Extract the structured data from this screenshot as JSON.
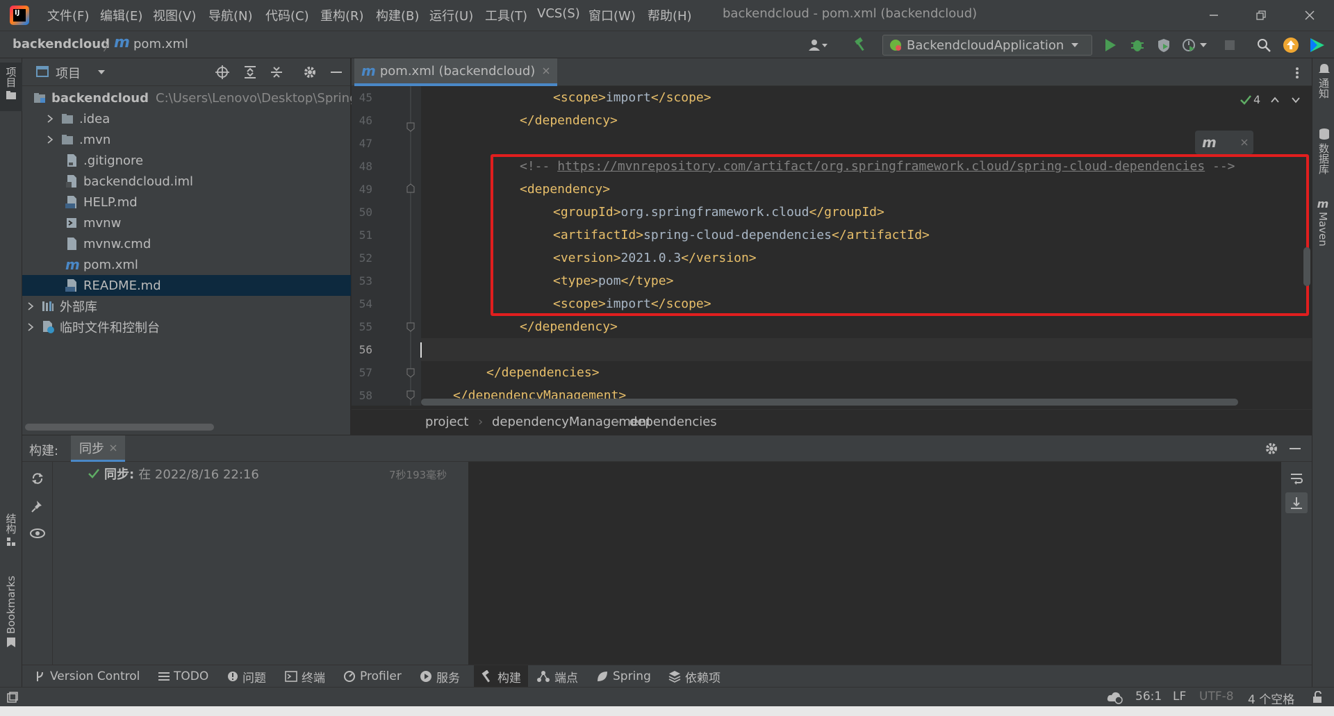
{
  "app": {
    "title": "backendcloud - pom.xml (backendcloud)"
  },
  "menu": [
    "文件(F)",
    "编辑(E)",
    "视图(V)",
    "导航(N)",
    "代码(C)",
    "重构(R)",
    "构建(B)",
    "运行(U)",
    "工具(T)",
    "VCS(S)",
    "窗口(W)",
    "帮助(H)"
  ],
  "nav": {
    "project": "backendcloud",
    "file": "pom.xml",
    "run_config": "BackendcloudApplication"
  },
  "left_strip": {
    "project_label": "项目",
    "structure_label": "结构",
    "bookmarks_label": "Bookmarks"
  },
  "right_strip": {
    "notifications_label": "通知",
    "database_label": "数据库",
    "maven_label": "Maven"
  },
  "project_panel": {
    "title": "项目",
    "root": {
      "name": "backendcloud",
      "path": "C:\\Users\\Lenovo\\Desktop\\Spring"
    },
    "items": [
      ".idea",
      ".mvn",
      ".gitignore",
      "backendcloud.iml",
      "HELP.md",
      "mvnw",
      "mvnw.cmd",
      "pom.xml",
      "README.md"
    ],
    "external_libraries": "外部库",
    "scratches": "临时文件和控制台"
  },
  "editor": {
    "tab_label": "pom.xml (backendcloud)",
    "inspection_count": "4",
    "line_numbers": [
      "45",
      "46",
      "47",
      "48",
      "49",
      "50",
      "51",
      "52",
      "53",
      "54",
      "55",
      "56",
      "57",
      "58"
    ],
    "code": {
      "l45_open": "<scope>",
      "l45_text": "import",
      "l45_close": "</scope>",
      "l46": "</dependency>",
      "l48_open": "<!-- ",
      "l48_url": "https://mvnrepository.com/artifact/org.springframework.cloud/spring-cloud-dependencies",
      "l48_close": " -->",
      "l49": "<dependency>",
      "l50_open": "<groupId>",
      "l50_text": "org.springframework.cloud",
      "l50_close": "</groupId>",
      "l51_open": "<artifactId>",
      "l51_text": "spring-cloud-dependencies",
      "l51_close": "</artifactId>",
      "l52_open": "<version>",
      "l52_text": "2021.0.3",
      "l52_close": "</version>",
      "l53_open": "<type>",
      "l53_text": "pom",
      "l53_close": "</type>",
      "l54_open": "<scope>",
      "l54_text": "import",
      "l54_close": "</scope>",
      "l55": "</dependency>",
      "l57": "</dependencies>",
      "l58": "</dependencyManagement>"
    },
    "breadcrumbs": [
      "project",
      "dependencyManagement",
      "dependencies"
    ]
  },
  "build_panel": {
    "label": "构建:",
    "tab": "同步",
    "sync_label": "同步:",
    "sync_text": "在 2022/8/16 22:16",
    "duration": "7秒193毫秒"
  },
  "bottom_tools": [
    "Version Control",
    "TODO",
    "问题",
    "终端",
    "Profiler",
    "服务",
    "构建",
    "端点",
    "Spring",
    "依赖项"
  ],
  "status": {
    "position": "56:1",
    "line_sep": "LF",
    "encoding": "UTF-8",
    "indent": "4 个空格"
  },
  "colors": {
    "accent": "#4a88c7",
    "highlight_box": "#e01e1e",
    "tag": "#e8bf6a",
    "run_green": "#499c54"
  }
}
